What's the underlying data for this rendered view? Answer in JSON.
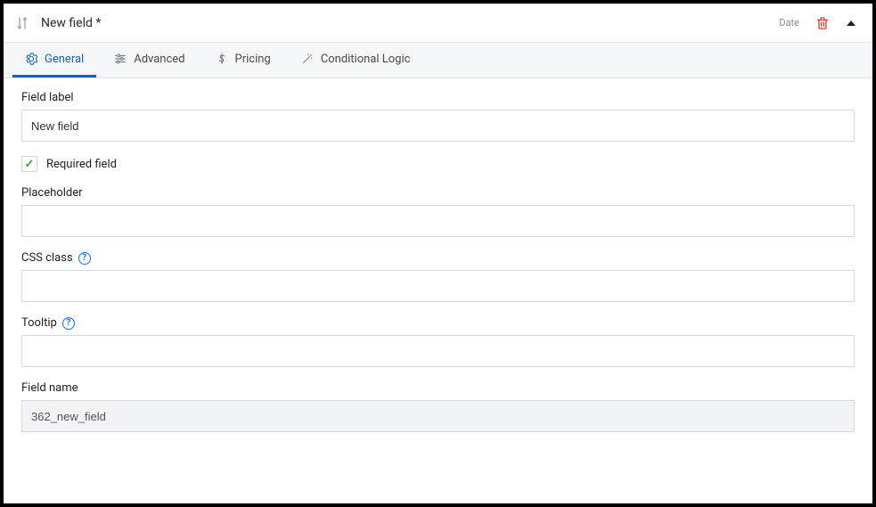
{
  "header": {
    "title": "New field *",
    "type_badge": "Date"
  },
  "tabs": [
    {
      "label": "General",
      "active": true
    },
    {
      "label": "Advanced",
      "active": false
    },
    {
      "label": "Pricing",
      "active": false
    },
    {
      "label": "Conditional Logic",
      "active": false
    }
  ],
  "form": {
    "field_label": {
      "label": "Field label",
      "value": "New field"
    },
    "required": {
      "label": "Required field",
      "checked": true
    },
    "placeholder": {
      "label": "Placeholder",
      "value": ""
    },
    "css_class": {
      "label": "CSS class",
      "value": "",
      "help": true
    },
    "tooltip": {
      "label": "Tooltip",
      "value": "",
      "help": true
    },
    "field_name": {
      "label": "Field name",
      "value": "362_new_field",
      "readonly": true
    }
  },
  "glyph": {
    "help": "?",
    "check": "✓"
  }
}
